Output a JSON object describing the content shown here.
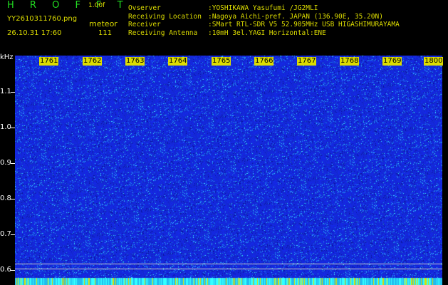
{
  "header": {
    "app_title": "H R O F F T",
    "version": "1.00f",
    "filename": "YY2610311760.png",
    "meteor_label": "meteor",
    "datetime": "26.10.31 17:60",
    "meteor_count": "111"
  },
  "info": [
    {
      "key": "Ovserver",
      "value": ":YOSHIKAWA Yasufumi /JG2MLI"
    },
    {
      "key": "Receiving Location",
      "value": ":Nagoya Aichi-pref. JAPAN (136.90E, 35.20N)"
    },
    {
      "key": "Receiver",
      "value": ":SMart RTL-SDR V5 52.905MHz USB HIGASHIMURAYAMA"
    },
    {
      "key": "Receiving Antenna",
      "value": ":10mH 3el.YAGI Horizontal:ENE"
    }
  ],
  "axis": {
    "y_unit": "kHz",
    "y_ticks": [
      "1.1",
      "1.0",
      "0.9",
      "0.8",
      "0.7",
      "0.6"
    ],
    "x_ticks": [
      "1761",
      "1762",
      "1763",
      "1764",
      "1765",
      "1766",
      "1767",
      "1768",
      "1769",
      "1800"
    ]
  },
  "colors": {
    "background": "#000000",
    "spectrogram_base": "#1a2fd0",
    "noise_bright": "#33ddff",
    "label_yellow": "#dddd00",
    "title_green": "#22dd22"
  }
}
